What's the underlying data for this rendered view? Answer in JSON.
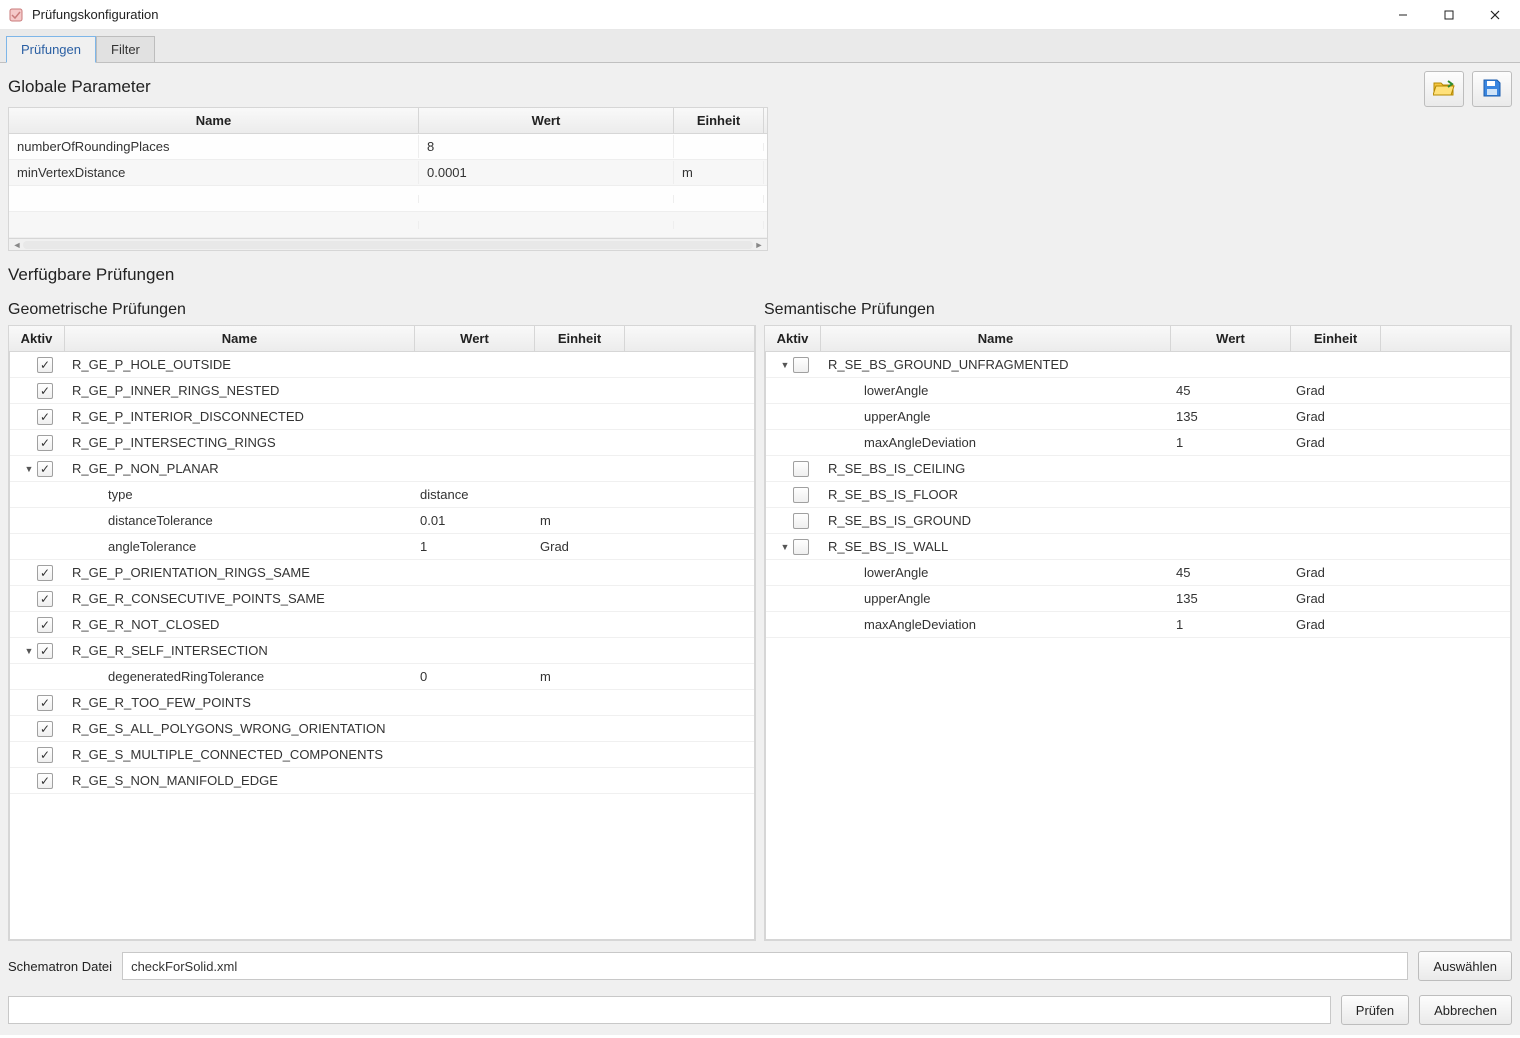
{
  "window": {
    "title": "Prüfungskonfiguration"
  },
  "tabs": {
    "pruefungen": "Prüfungen",
    "filter": "Filter",
    "active": "pruefungen"
  },
  "icons": {
    "open": "folder-open-icon",
    "save": "save-icon"
  },
  "sections": {
    "global": "Globale Parameter",
    "available": "Verfügbare Prüfungen",
    "geometric": "Geometrische Prüfungen",
    "semantic": "Semantische Prüfungen"
  },
  "headers": {
    "name": "Name",
    "wert": "Wert",
    "einheit": "Einheit",
    "aktiv": "Aktiv"
  },
  "global_params": [
    {
      "name": "numberOfRoundingPlaces",
      "wert": "8",
      "einheit": ""
    },
    {
      "name": "minVertexDistance",
      "wert": "0.0001",
      "einheit": "m"
    },
    {
      "name": "",
      "wert": "",
      "einheit": ""
    },
    {
      "name": "",
      "wert": "",
      "einheit": ""
    }
  ],
  "geometric": [
    {
      "type": "check",
      "checked": true,
      "name": "R_GE_P_HOLE_OUTSIDE"
    },
    {
      "type": "check",
      "checked": true,
      "name": "R_GE_P_INNER_RINGS_NESTED"
    },
    {
      "type": "check",
      "checked": true,
      "name": "R_GE_P_INTERIOR_DISCONNECTED"
    },
    {
      "type": "check",
      "checked": true,
      "name": "R_GE_P_INTERSECTING_RINGS"
    },
    {
      "type": "check",
      "checked": true,
      "expanded": true,
      "name": "R_GE_P_NON_PLANAR"
    },
    {
      "type": "param",
      "name": "type",
      "wert": "distance",
      "einheit": ""
    },
    {
      "type": "param",
      "name": "distanceTolerance",
      "wert": "0.01",
      "einheit": "m"
    },
    {
      "type": "param",
      "name": "angleTolerance",
      "wert": "1",
      "einheit": "Grad"
    },
    {
      "type": "check",
      "checked": true,
      "name": "R_GE_P_ORIENTATION_RINGS_SAME"
    },
    {
      "type": "check",
      "checked": true,
      "name": "R_GE_R_CONSECUTIVE_POINTS_SAME"
    },
    {
      "type": "check",
      "checked": true,
      "name": "R_GE_R_NOT_CLOSED"
    },
    {
      "type": "check",
      "checked": true,
      "expanded": true,
      "name": "R_GE_R_SELF_INTERSECTION"
    },
    {
      "type": "param",
      "name": "degeneratedRingTolerance",
      "wert": "0",
      "einheit": "m"
    },
    {
      "type": "check",
      "checked": true,
      "name": "R_GE_R_TOO_FEW_POINTS"
    },
    {
      "type": "check",
      "checked": true,
      "name": "R_GE_S_ALL_POLYGONS_WRONG_ORIENTATION"
    },
    {
      "type": "check",
      "checked": true,
      "name": "R_GE_S_MULTIPLE_CONNECTED_COMPONENTS"
    },
    {
      "type": "check",
      "checked": true,
      "name": "R_GE_S_NON_MANIFOLD_EDGE"
    }
  ],
  "semantic": [
    {
      "type": "check",
      "checked": false,
      "expanded": true,
      "name": "R_SE_BS_GROUND_UNFRAGMENTED"
    },
    {
      "type": "param",
      "name": "lowerAngle",
      "wert": "45",
      "einheit": "Grad"
    },
    {
      "type": "param",
      "name": "upperAngle",
      "wert": "135",
      "einheit": "Grad"
    },
    {
      "type": "param",
      "name": "maxAngleDeviation",
      "wert": "1",
      "einheit": "Grad"
    },
    {
      "type": "check",
      "checked": false,
      "name": "R_SE_BS_IS_CEILING"
    },
    {
      "type": "check",
      "checked": false,
      "name": "R_SE_BS_IS_FLOOR"
    },
    {
      "type": "check",
      "checked": false,
      "name": "R_SE_BS_IS_GROUND"
    },
    {
      "type": "check",
      "checked": false,
      "expanded": true,
      "name": "R_SE_BS_IS_WALL"
    },
    {
      "type": "param",
      "name": "lowerAngle",
      "wert": "45",
      "einheit": "Grad"
    },
    {
      "type": "param",
      "name": "upperAngle",
      "wert": "135",
      "einheit": "Grad"
    },
    {
      "type": "param",
      "name": "maxAngleDeviation",
      "wert": "1",
      "einheit": "Grad"
    }
  ],
  "schematron": {
    "label": "Schematron Datei",
    "value": "checkForSolid.xml",
    "browse": "Auswählen"
  },
  "buttons": {
    "pruefen": "Prüfen",
    "abbrechen": "Abbrechen"
  }
}
